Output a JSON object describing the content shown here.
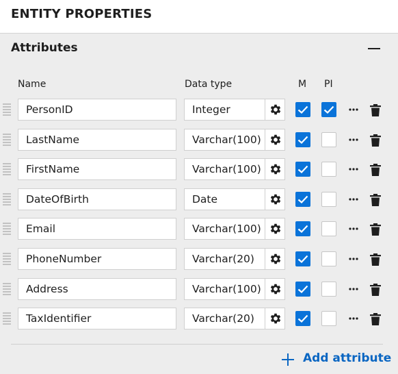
{
  "panel": {
    "title": "ENTITY PROPERTIES"
  },
  "section": {
    "title": "Attributes",
    "collapse_icon": "minus-icon"
  },
  "columns": {
    "name": "Name",
    "data_type": "Data type",
    "mandatory": "M",
    "pi": "PI"
  },
  "attributes": [
    {
      "name": "PersonID",
      "data_type": "Integer",
      "mandatory": true,
      "pi": true
    },
    {
      "name": "LastName",
      "data_type": "Varchar(100)",
      "mandatory": true,
      "pi": false
    },
    {
      "name": "FirstName",
      "data_type": "Varchar(100)",
      "mandatory": true,
      "pi": false
    },
    {
      "name": "DateOfBirth",
      "data_type": "Date",
      "mandatory": true,
      "pi": false
    },
    {
      "name": "Email",
      "data_type": "Varchar(100)",
      "mandatory": true,
      "pi": false
    },
    {
      "name": "PhoneNumber",
      "data_type": "Varchar(20)",
      "mandatory": true,
      "pi": false
    },
    {
      "name": "Address",
      "data_type": "Varchar(100)",
      "mandatory": true,
      "pi": false
    },
    {
      "name": "TaxIdentifier",
      "data_type": "Varchar(20)",
      "mandatory": true,
      "pi": false
    }
  ],
  "add_attribute": {
    "label": "Add attribute",
    "icon": "plus-icon"
  },
  "colors": {
    "accent": "#0a73d9",
    "link": "#0a66c2",
    "background": "#ededed"
  }
}
